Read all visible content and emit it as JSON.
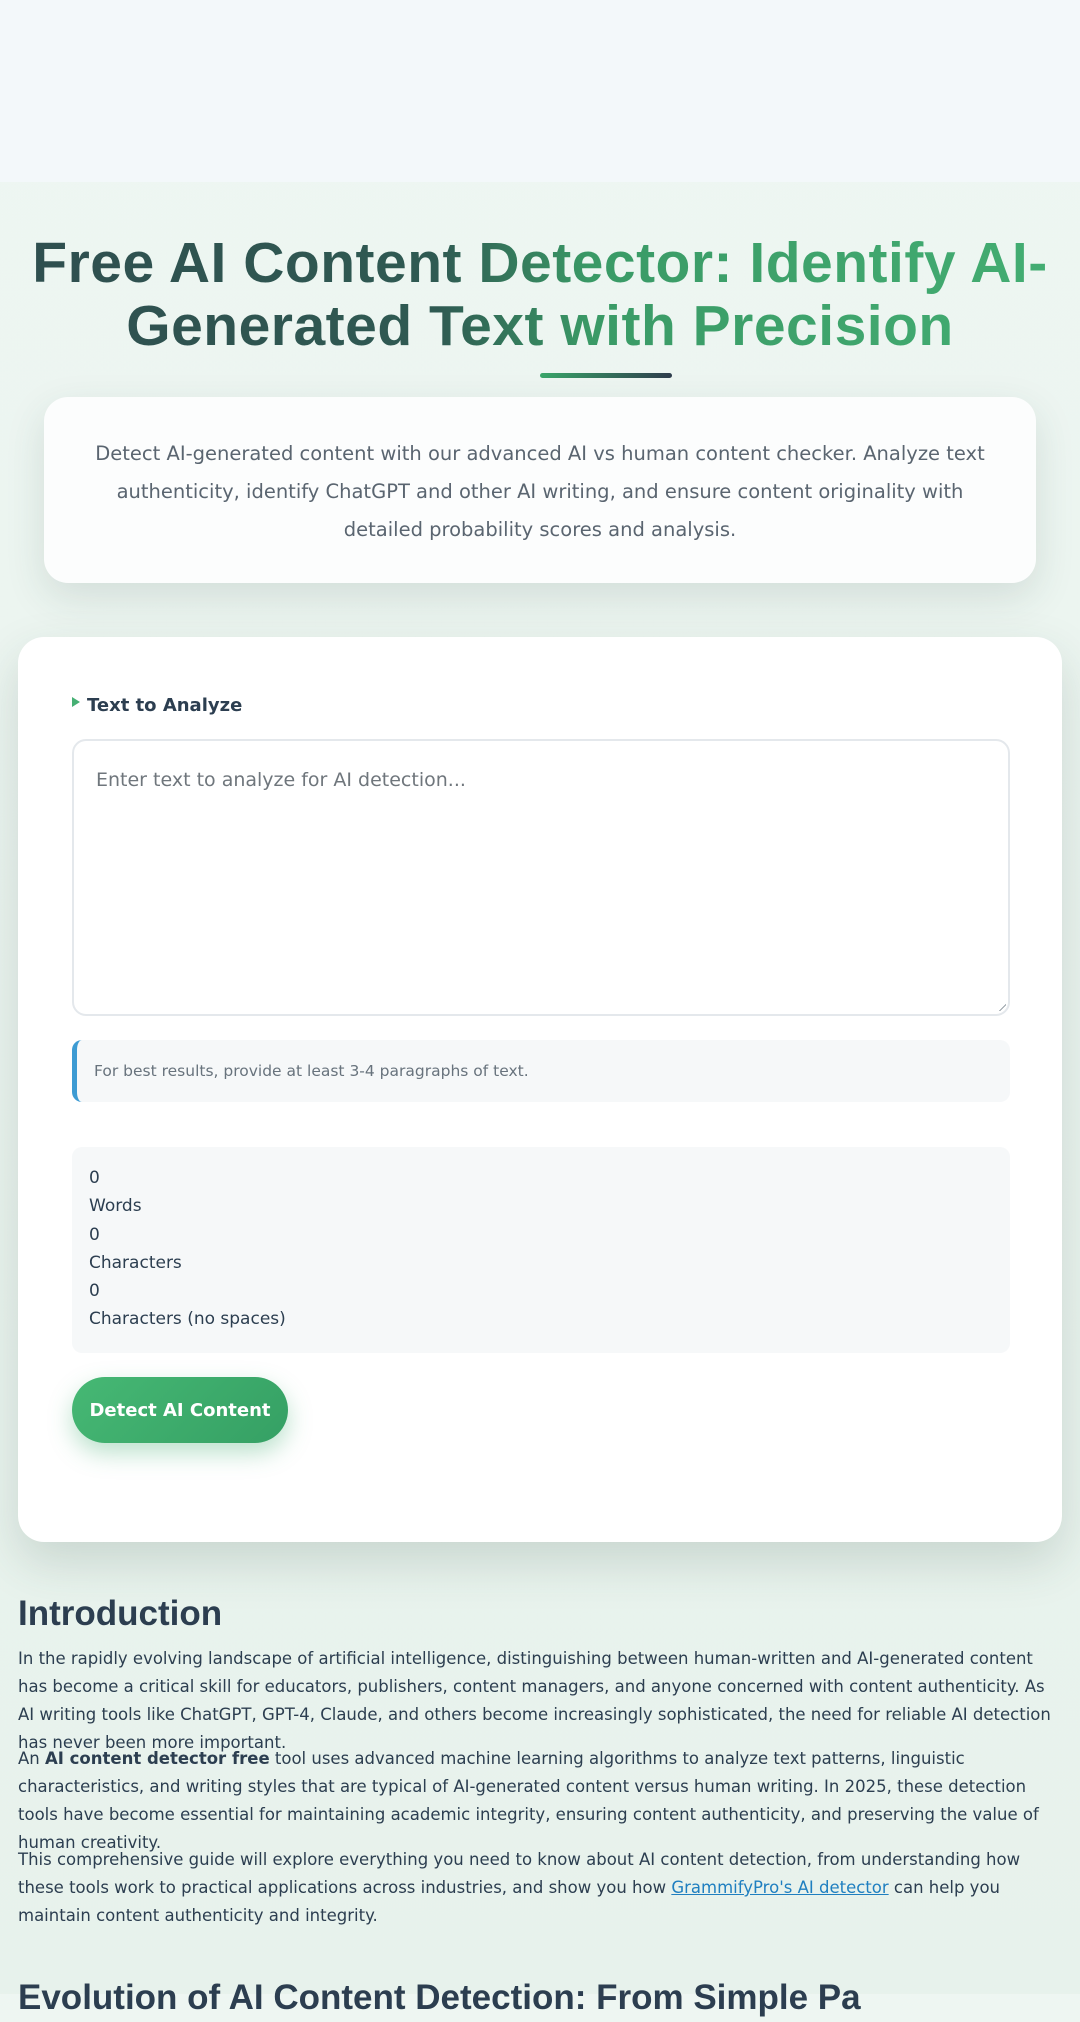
{
  "hero": {
    "title": "Free AI Content Detector: Identify AI-Generated Text with Precision",
    "description": "Detect AI-generated content with our advanced AI vs human content checker. Analyze text authenticity, identify ChatGPT and other AI writing, and ensure content originality with detailed probability scores and analysis."
  },
  "tool": {
    "label": "Text to Analyze",
    "placeholder": "Enter text to analyze for AI detection...",
    "hint": "For best results, provide at least 3-4 paragraphs of text.",
    "stats": {
      "words_value": "0",
      "words_label": "Words",
      "chars_value": "0",
      "chars_label": "Characters",
      "chars_nospace_value": "0",
      "chars_nospace_label": "Characters (no spaces)"
    },
    "detect_label": "Detect AI Content"
  },
  "article": {
    "heading": "Introduction",
    "p1": "In the rapidly evolving landscape of artificial intelligence, distinguishing between human-written and AI-generated content has become a critical skill for educators, publishers, content managers, and anyone concerned with content authenticity. As AI writing tools like ChatGPT, GPT-4, Claude, and others become increasingly sophisticated, the need for reliable AI detection has never been more important.",
    "p2_prefix": "An ",
    "p2_bold": "AI content detector free",
    "p2_suffix": " tool uses advanced machine learning algorithms to analyze text patterns, linguistic characteristics, and writing styles that are typical of AI-generated content versus human writing. In 2025, these detection tools have become essential for maintaining academic integrity, ensuring content authenticity, and preserving the value of human creativity.",
    "p3_prefix": "This comprehensive guide will explore everything you need to know about AI content detection, from understanding how these tools work to practical applications across industries, and show you how ",
    "p3_link": "GrammifyPro's AI detector",
    "p3_suffix": " can help you maintain content authenticity and integrity.",
    "next_heading": "Evolution of AI Content Detection: From Simple Pa"
  }
}
